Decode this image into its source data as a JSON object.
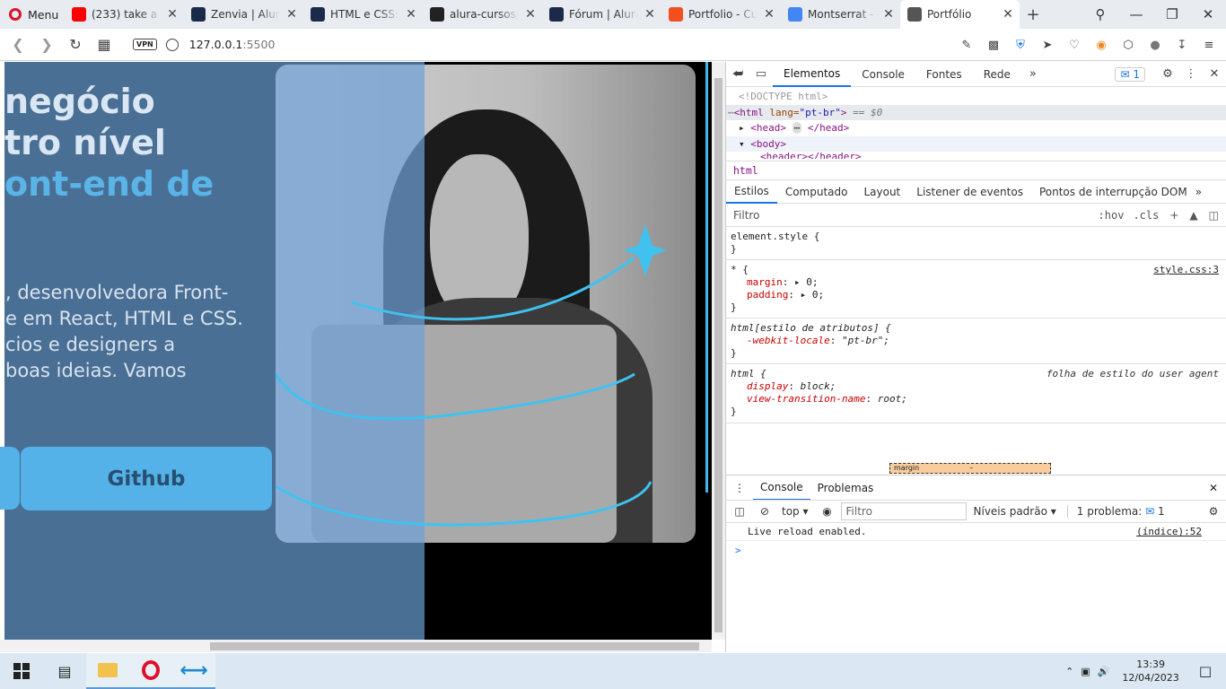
{
  "browser": {
    "menu_label": "Menu",
    "tabs": [
      {
        "label": "(233) take a de",
        "icon": "youtube-icon",
        "color": "#ff0000"
      },
      {
        "label": "Zenvia | Alura",
        "icon": "alura-icon",
        "color": "#1b2a4a"
      },
      {
        "label": "HTML e CSS: C",
        "icon": "alura-icon",
        "color": "#1b2a4a"
      },
      {
        "label": "alura-cursos/P",
        "icon": "github-icon",
        "color": "#222222"
      },
      {
        "label": "Fórum | Alura",
        "icon": "alura-icon",
        "color": "#1b2a4a"
      },
      {
        "label": "Portfolio - Cur",
        "icon": "figma-icon",
        "color": "#f24e1e"
      },
      {
        "label": "Montserrat - G",
        "icon": "google-fonts-icon",
        "color": "#4285f4"
      },
      {
        "label": "Portfólio",
        "icon": "globe-icon",
        "color": "#555555",
        "active": true
      }
    ],
    "url": "127.0.0.1:5500",
    "url_host": "127.0.0.1",
    "url_port": ":5500",
    "vpn_label": "VPN"
  },
  "page": {
    "hero_line1": "negócio",
    "hero_line2": "tro nível",
    "hero_line3": "ont-end de",
    "paragraph_lines": [
      ", desenvolvedora Front-",
      "e em React, HTML e CSS.",
      "cios e designers a",
      " boas ideias. Vamos"
    ],
    "github_button": "Github",
    "colors": {
      "accent": "#54b2e8",
      "background": "#4a6f94",
      "heading": "#d9e6f4"
    }
  },
  "devtools": {
    "tabs": [
      "Elementos",
      "Console",
      "Fontes",
      "Rede"
    ],
    "issues_badge": "1",
    "dom": {
      "doctype": "<!DOCTYPE html>",
      "html_open": "<html",
      "html_attr": " lang=",
      "html_lang": "\"pt-br\"",
      "html_close": ">",
      "html_eq": "== $0",
      "head": "<head>",
      "head_ellipsis": "⋯",
      "head_close": "</head>",
      "body": "<body>",
      "header": "<header></header>"
    },
    "breadcrumb": "html",
    "style_tabs": [
      "Estilos",
      "Computado",
      "Layout",
      "Listener de eventos",
      "Pontos de interrupção DOM"
    ],
    "filter_placeholder": "Filtro",
    "hov": ":hov",
    "cls": ".cls",
    "rules": [
      {
        "selector": "element.style {",
        "close": "}"
      },
      {
        "selector": "* {",
        "source": "style.css:3",
        "props": [
          {
            "name": "margin",
            "value": "0;"
          },
          {
            "name": "padding",
            "value": "0;"
          }
        ],
        "close": "}"
      },
      {
        "selector": "html[estilo de atributos] {",
        "props": [
          {
            "name": "-webkit-locale",
            "value": "\"pt-br\";"
          }
        ],
        "close": "}"
      },
      {
        "selector": "html {",
        "source": "folha de estilo do user agent",
        "props": [
          {
            "name": "display",
            "value": "block;"
          },
          {
            "name": "view-transition-name",
            "value": "root;"
          }
        ],
        "close": "}"
      }
    ],
    "boxmodel_label": "margin",
    "boxmodel_value": "–",
    "console": {
      "tabs": [
        "Console",
        "Problemas"
      ],
      "context": "top",
      "filter": "Filtro",
      "levels": "Níveis padrão",
      "problems": "1 problema:",
      "problems_count": "1",
      "message": "Live reload enabled.",
      "message_source": "(índice):52",
      "prompt": ">"
    }
  },
  "taskbar": {
    "time": "13:39",
    "date": "12/04/2023"
  }
}
